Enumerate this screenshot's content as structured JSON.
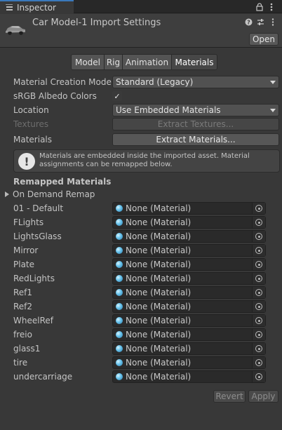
{
  "window": {
    "tab_label": "Inspector",
    "tab_icon": "inspector-icon",
    "lock_icon": "lock-icon",
    "menu_icon": "kebab-menu-icon"
  },
  "header": {
    "title": "Car Model-1 Import Settings",
    "open_label": "Open",
    "help_icon": "help-icon",
    "preset_icon": "preset-icon",
    "menu_icon": "kebab-menu-icon"
  },
  "tabs": [
    {
      "label": "Model",
      "active": false
    },
    {
      "label": "Rig",
      "active": false
    },
    {
      "label": "Animation",
      "active": false
    },
    {
      "label": "Materials",
      "active": true
    }
  ],
  "fields": {
    "material_creation_mode": {
      "label": "Material Creation Mode",
      "value": "Standard (Legacy)"
    },
    "srgb_albedo": {
      "label": "sRGB Albedo Colors",
      "checked": true,
      "check_glyph": "✓"
    },
    "location": {
      "label": "Location",
      "value": "Use Embedded Materials"
    },
    "textures": {
      "label": "Textures",
      "button": "Extract Textures..."
    },
    "materials": {
      "label": "Materials",
      "button": "Extract Materials..."
    }
  },
  "info": {
    "icon": "!",
    "text": "Materials are embedded inside the imported asset. Material assignments can be remapped below."
  },
  "remapped": {
    "title": "Remapped Materials",
    "foldout_label": "On Demand Remap",
    "items": [
      {
        "label": "01 - Default",
        "value": "None (Material)"
      },
      {
        "label": "FLights",
        "value": "None (Material)"
      },
      {
        "label": "LightsGlass",
        "value": "None (Material)"
      },
      {
        "label": "Mirror",
        "value": "None (Material)"
      },
      {
        "label": "Plate",
        "value": "None (Material)"
      },
      {
        "label": "RedLights",
        "value": "None (Material)"
      },
      {
        "label": "Ref1",
        "value": "None (Material)"
      },
      {
        "label": "Ref2",
        "value": "None (Material)"
      },
      {
        "label": "WheelRef",
        "value": "None (Material)"
      },
      {
        "label": "freio",
        "value": "None (Material)"
      },
      {
        "label": "glass1",
        "value": "None (Material)"
      },
      {
        "label": "tire",
        "value": "None (Material)"
      },
      {
        "label": "undercarriage",
        "value": "None (Material)"
      }
    ]
  },
  "footer": {
    "revert_label": "Revert",
    "apply_label": "Apply"
  },
  "colors": {
    "background": "#383838",
    "tab_accent": "#3a79bb",
    "active_tab": "#474747",
    "button": "#575757"
  }
}
